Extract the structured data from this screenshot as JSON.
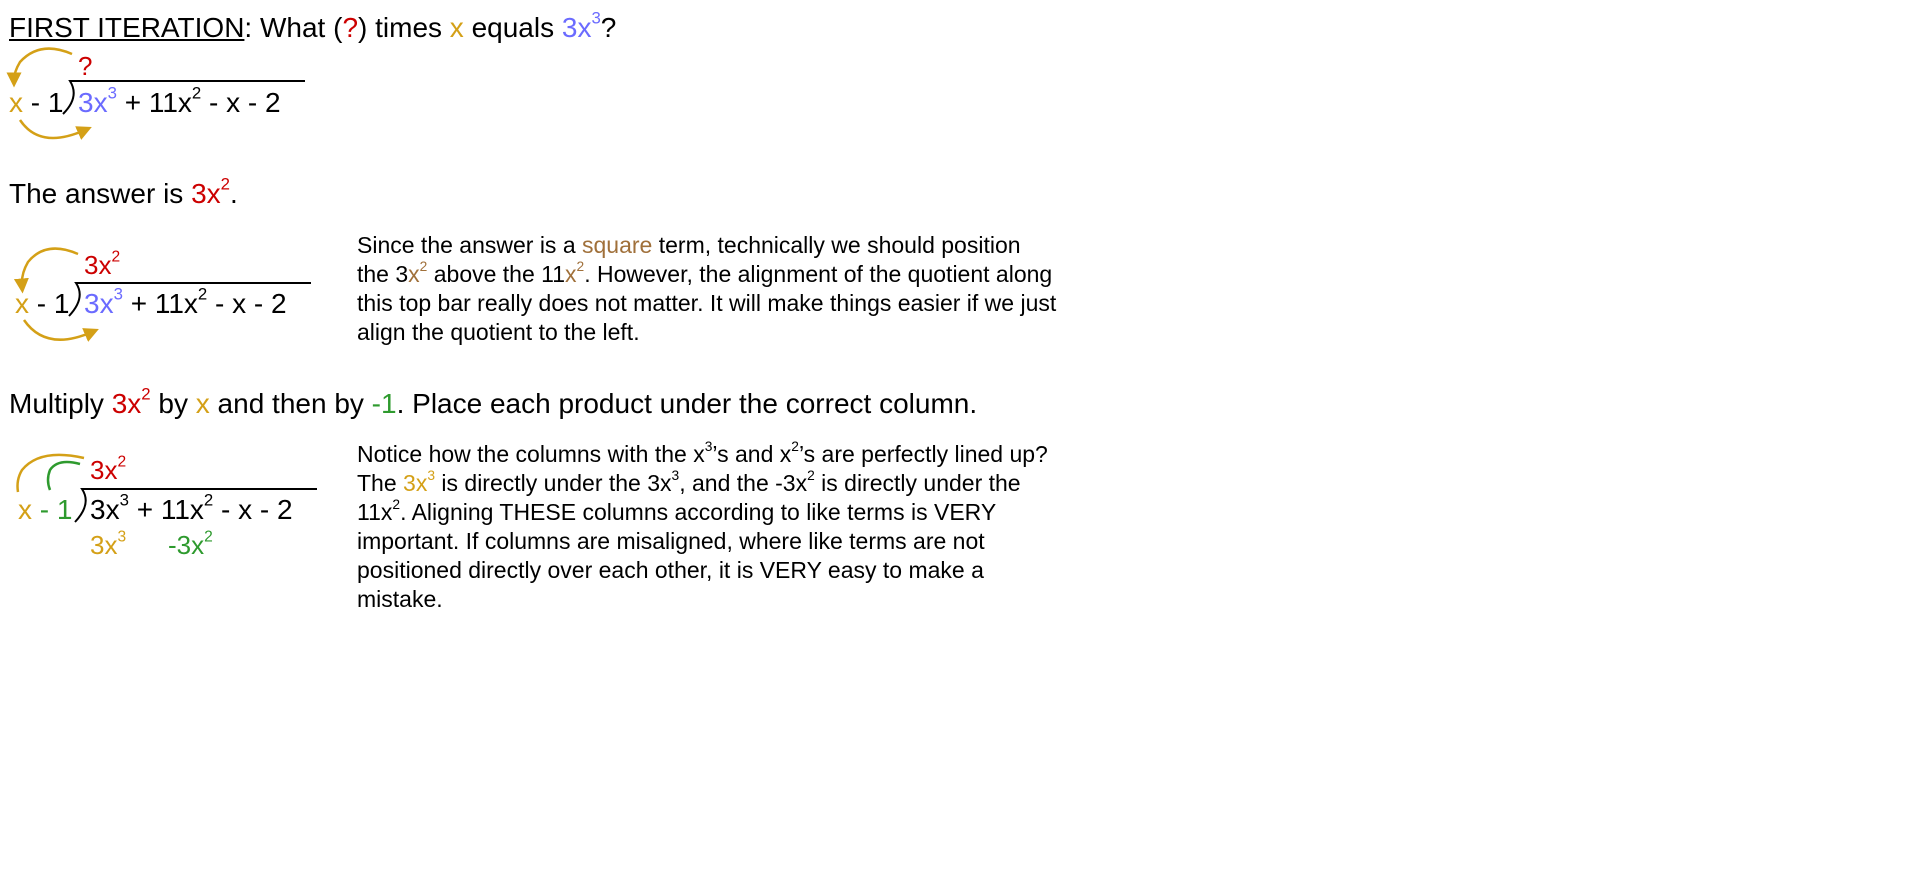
{
  "colors": {
    "red": "#cc0000",
    "gold": "#d4a017",
    "blue": "#6b6bff",
    "brown": "#a0703a",
    "green": "#2e9a2e",
    "black": "#000000"
  },
  "heading1": {
    "label": "FIRST ITERATION",
    "t1": ":  What (",
    "q": "?",
    "t2": ") times ",
    "x": "x",
    "t3": " equals ",
    "term": "3x",
    "exp": "3",
    "t4": "?"
  },
  "div1": {
    "quotient": "?",
    "divisor_x": "x",
    "divisor_rest": " - 1",
    "lead": "3x",
    "lead_exp": "3",
    "rest_a": " + 11x",
    "rest_exp": "2",
    "rest_b": " - x - 2"
  },
  "heading2": {
    "t1": "The answer is ",
    "term": "3x",
    "exp": "2",
    "t2": "."
  },
  "div2": {
    "quotient": "3x",
    "quotient_exp": "2",
    "divisor_x": "x",
    "divisor_rest": " - 1",
    "lead": "3x",
    "lead_exp": "3",
    "rest_a": " + 11x",
    "rest_exp": "2",
    "rest_b": " - x - 2"
  },
  "para1": {
    "t1": "Since the answer is a ",
    "square": "square",
    "t2": " term, technically we should position the 3",
    "x": "x",
    "exp1": "2",
    "t3": " above the 11",
    "x2": "x",
    "exp2": "2",
    "t4": ".  However, the alignment of the quotient along this top bar really does not matter.  It will make things easier if we just align the quotient to the left."
  },
  "heading3": {
    "t1": "Multiply ",
    "term": "3x",
    "exp": "2",
    "t2": " by ",
    "x": "x",
    "t3": " and then by ",
    "neg": "-1",
    "t4": ".  Place each product under the correct column."
  },
  "div3": {
    "quotient": "3x",
    "quotient_exp": "2",
    "divisor_x": "x",
    "divisor_rest": " - 1",
    "dividend_a": "3x",
    "dividend_exp": "3",
    "dividend_b": " + 11x",
    "dividend_exp2": "2",
    "dividend_c": " - x - 2",
    "product1": "3x",
    "product1_exp": "3",
    "product2": "-3x",
    "product2_exp": "2"
  },
  "para2": {
    "t1": "Notice how the columns with the x",
    "e1": "3",
    "t2": "’s and x",
    "e2": "2",
    "t3": "’s are perfectly lined up?  The ",
    "gold": "3x",
    "e3": "3",
    "t4": " is directly under the 3x",
    "e4": "3",
    "t5": ", and the -3x",
    "e5": "2",
    "t6": " is directly under the 11x",
    "e6": "2",
    "t7": ".  Aligning THESE columns according to like terms is VERY important.  If columns are misaligned, where like terms are not positioned directly over each other, it is VERY easy to make a mistake."
  }
}
